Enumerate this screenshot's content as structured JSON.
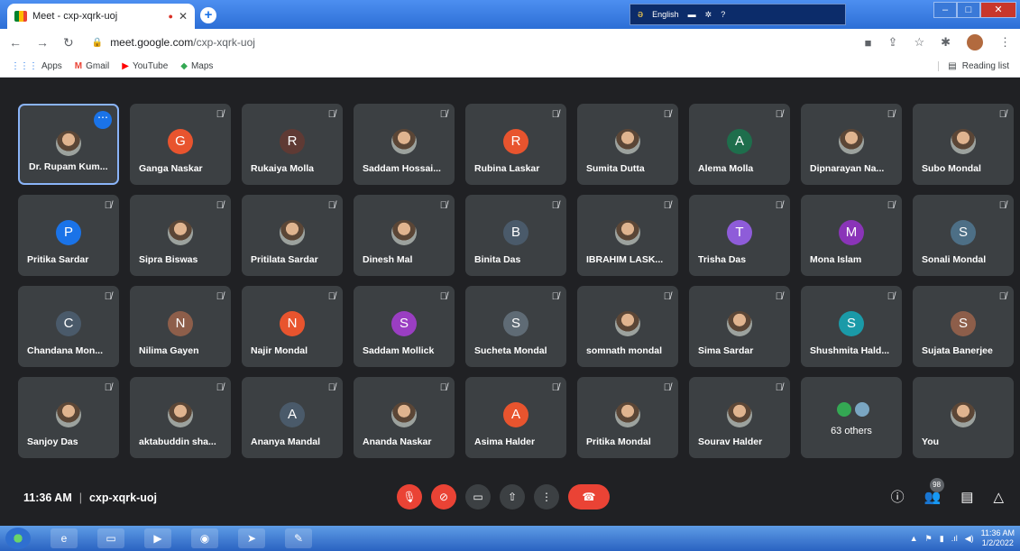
{
  "browser": {
    "tab_title": "Meet - cxp-xqrk-uoj",
    "new_tab_label": "+",
    "url_host": "meet.google.com",
    "url_path": "/cxp-xqrk-uoj",
    "language": "English",
    "bookmarks": [
      "Apps",
      "Gmail",
      "YouTube",
      "Maps"
    ],
    "reading_list": "Reading list"
  },
  "participants": [
    {
      "name": "Dr. Rupam Kum...",
      "initial": "",
      "color": "",
      "photo": true,
      "active": true
    },
    {
      "name": "Ganga Naskar",
      "initial": "G",
      "color": "#e8542e"
    },
    {
      "name": "Rukaiya Molla",
      "initial": "R",
      "color": "#5f3a34"
    },
    {
      "name": "Saddam Hossai...",
      "initial": "",
      "photo": true
    },
    {
      "name": "Rubina Laskar",
      "initial": "R",
      "color": "#e8542e"
    },
    {
      "name": "Sumita Dutta",
      "initial": "",
      "photo": true
    },
    {
      "name": "Alema Molla",
      "initial": "A",
      "color": "#1e6e4c"
    },
    {
      "name": "Dipnarayan Na...",
      "initial": "",
      "photo": true
    },
    {
      "name": "Subo Mondal",
      "initial": "",
      "photo": true
    },
    {
      "name": "Pritika Sardar",
      "initial": "P",
      "color": "#1a73e8"
    },
    {
      "name": "Sipra Biswas",
      "initial": "",
      "photo": true
    },
    {
      "name": "Pritilata Sardar",
      "initial": "",
      "photo": true
    },
    {
      "name": "Dinesh Mal",
      "initial": "",
      "photo": true
    },
    {
      "name": "Binita Das",
      "initial": "B",
      "color": "#4a5a6a"
    },
    {
      "name": "IBRAHIM LASK...",
      "initial": "",
      "photo": true
    },
    {
      "name": "Trisha Das",
      "initial": "T",
      "color": "#8e5cd9"
    },
    {
      "name": "Mona Islam",
      "initial": "M",
      "color": "#8a34b8"
    },
    {
      "name": "Sonali Mondal",
      "initial": "S",
      "color": "#4d6f86"
    },
    {
      "name": "Chandana Mon...",
      "initial": "C",
      "color": "#4a5a6a"
    },
    {
      "name": "Nilima Gayen",
      "initial": "N",
      "color": "#8d5e4a"
    },
    {
      "name": "Najir Mondal",
      "initial": "N",
      "color": "#e8542e"
    },
    {
      "name": "Saddam Mollick",
      "initial": "S",
      "color": "#9a3ec2"
    },
    {
      "name": "Sucheta Mondal",
      "initial": "S",
      "color": "#5f6b75"
    },
    {
      "name": "somnath mondal",
      "initial": "",
      "photo": true
    },
    {
      "name": "Sima Sardar",
      "initial": "",
      "photo": true
    },
    {
      "name": "Shushmita Hald...",
      "initial": "S",
      "color": "#1a9aa8"
    },
    {
      "name": "Sujata Banerjee",
      "initial": "S",
      "color": "#8d5e4a"
    },
    {
      "name": "Sanjoy Das",
      "initial": "",
      "photo": true
    },
    {
      "name": "aktabuddin sha...",
      "initial": "",
      "photo": true
    },
    {
      "name": "Ananya Mandal",
      "initial": "A",
      "color": "#4a5a6a"
    },
    {
      "name": "Ananda Naskar",
      "initial": "",
      "photo": true
    },
    {
      "name": "Asima Halder",
      "initial": "A",
      "color": "#e8542e"
    },
    {
      "name": "Pritika Mondal",
      "initial": "",
      "photo": true
    },
    {
      "name": "Sourav Halder",
      "initial": "",
      "photo": true
    },
    {
      "name": "63 others",
      "others": true
    },
    {
      "name": "You",
      "initial": "",
      "photo": true,
      "self": true
    }
  ],
  "meeting": {
    "time": "11:36 AM",
    "separator": "|",
    "code": "cxp-xqrk-uoj",
    "participant_count": "98"
  },
  "taskbar": {
    "clock_time": "11:36 AM",
    "clock_date": "1/2/2022"
  }
}
